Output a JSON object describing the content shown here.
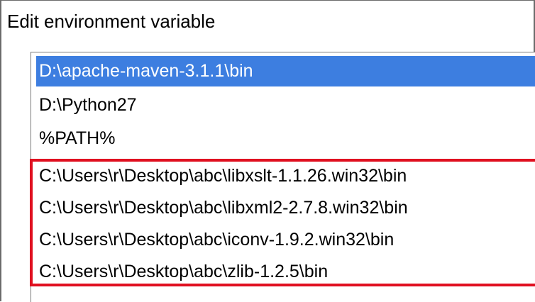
{
  "dialog": {
    "title": "Edit environment variable"
  },
  "colors": {
    "selection_background": "#3d7ee0",
    "selection_text": "#ffffff",
    "annotation_outline": "#e01020"
  },
  "path_list": {
    "selected_index": 0,
    "items": [
      "D:\\apache-maven-3.1.1\\bin",
      "D:\\Python27",
      "%PATH%",
      "C:\\Users\\r\\Desktop\\abc\\libxslt-1.1.26.win32\\bin",
      "C:\\Users\\r\\Desktop\\abc\\libxml2-2.7.8.win32\\bin",
      "C:\\Users\\r\\Desktop\\abc\\iconv-1.9.2.win32\\bin",
      "C:\\Users\\r\\Desktop\\abc\\zlib-1.2.5\\bin"
    ],
    "highlighted_items": [
      3,
      4,
      5,
      6
    ]
  }
}
